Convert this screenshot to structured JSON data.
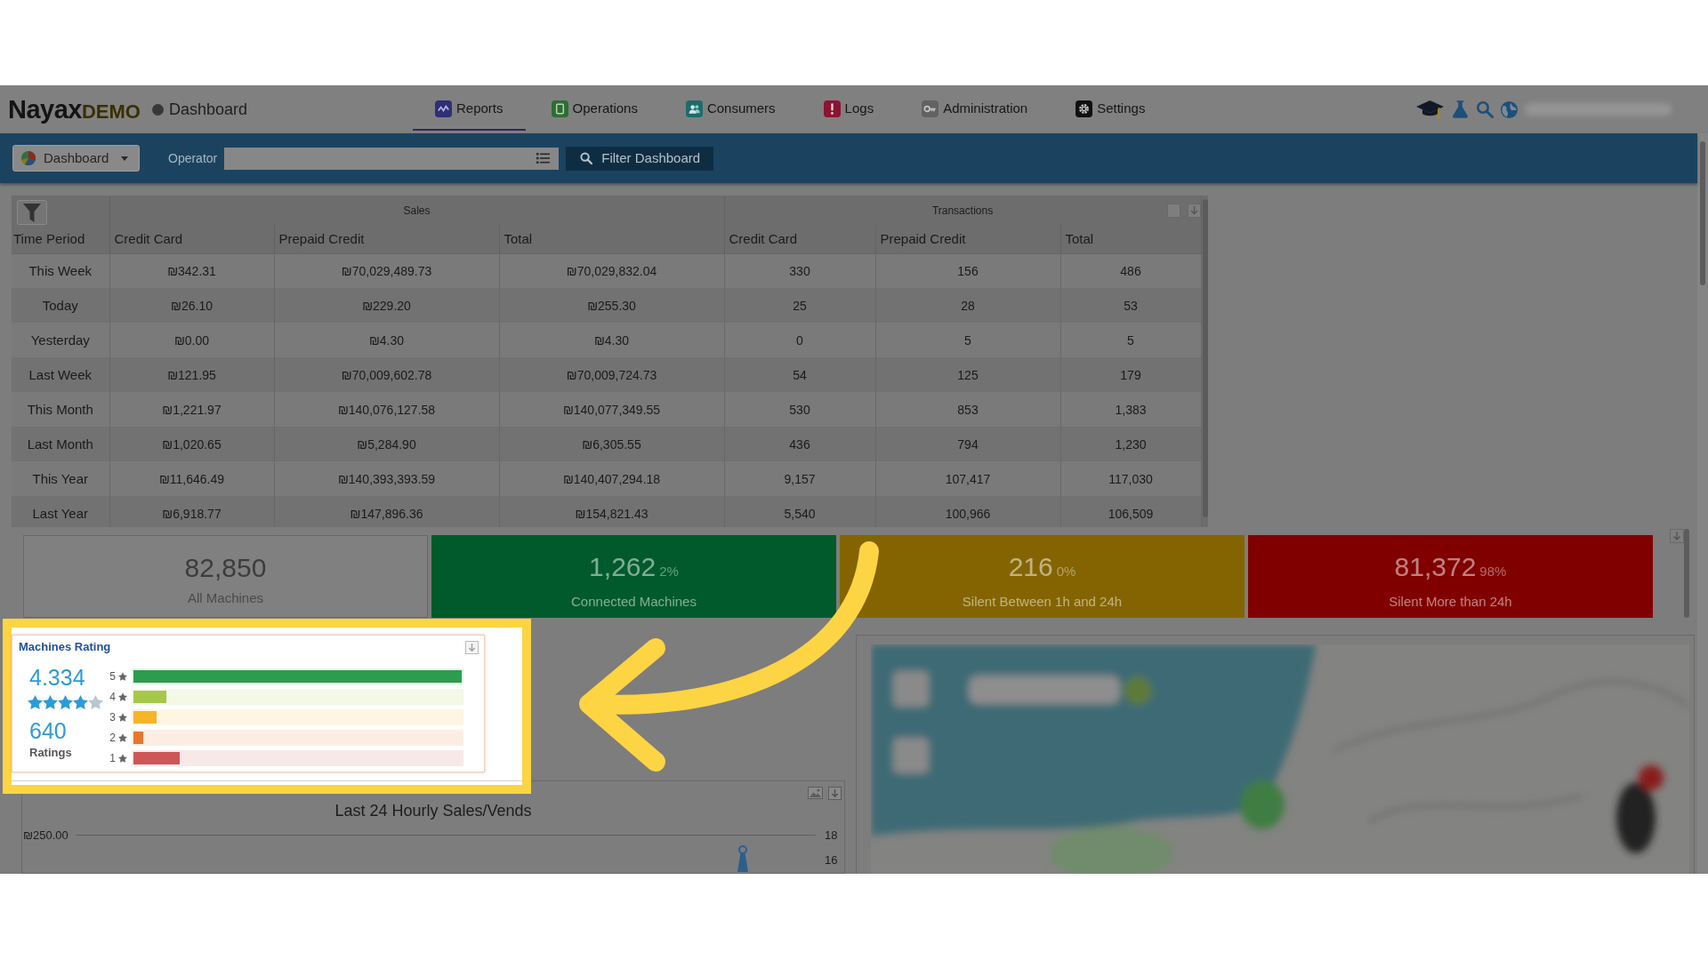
{
  "nav": {
    "logo": "Nayax",
    "logo_tag": "DEMO",
    "page_title": "Dashboard",
    "tabs": [
      {
        "label": "Reports",
        "selected": true
      },
      {
        "label": "Operations",
        "selected": false
      },
      {
        "label": "Consumers",
        "selected": false
      },
      {
        "label": "Logs",
        "selected": false
      },
      {
        "label": "Administration",
        "selected": false
      },
      {
        "label": "Settings",
        "selected": false
      }
    ]
  },
  "toolbar": {
    "dashboard_menu": "Dashboard",
    "operator_label": "Operator",
    "filter_button": "Filter Dashboard"
  },
  "summary_table": {
    "groups": [
      "Sales",
      "Transactions"
    ],
    "columns": [
      "Time Period",
      "Credit Card",
      "Prepaid Credit",
      "Total",
      "Credit Card",
      "Prepaid Credit",
      "Total"
    ],
    "rows": [
      [
        "This Week",
        "₪342.31",
        "₪70,029,489.73",
        "₪70,029,832.04",
        "330",
        "156",
        "486"
      ],
      [
        "Today",
        "₪26.10",
        "₪229.20",
        "₪255.30",
        "25",
        "28",
        "53"
      ],
      [
        "Yesterday",
        "₪0.00",
        "₪4.30",
        "₪4.30",
        "0",
        "5",
        "5"
      ],
      [
        "Last Week",
        "₪121.95",
        "₪70,009,602.78",
        "₪70,009,724.73",
        "54",
        "125",
        "179"
      ],
      [
        "This Month",
        "₪1,221.97",
        "₪140,076,127.58",
        "₪140,077,349.55",
        "530",
        "853",
        "1,383"
      ],
      [
        "Last Month",
        "₪1,020.65",
        "₪5,284.90",
        "₪6,305.55",
        "436",
        "794",
        "1,230"
      ],
      [
        "This Year",
        "₪11,646.49",
        "₪140,393,393.59",
        "₪140,407,294.18",
        "9,157",
        "107,417",
        "117,030"
      ],
      [
        "Last Year",
        "₪6,918.77",
        "₪147,896.36",
        "₪154,821.43",
        "5,540",
        "100,966",
        "106,509"
      ]
    ]
  },
  "machine_status": [
    {
      "kind": "outline",
      "count": "82,850",
      "label": "All Machines",
      "color": "#808080"
    },
    {
      "kind": "filled",
      "count": "1,262",
      "percent": "2%",
      "label": "Connected Machines",
      "color": "#005a2b"
    },
    {
      "kind": "filled",
      "count": "216",
      "percent": "0%",
      "label": "Silent Between 1h and 24h",
      "color": "#846400"
    },
    {
      "kind": "filled",
      "count": "81,372",
      "percent": "98%",
      "label": "Silent More than 24h",
      "color": "#800000"
    }
  ],
  "machines_rating": {
    "title": "Machines Rating",
    "average": "4.334",
    "stars": 4,
    "count": "640",
    "count_label": "Ratings",
    "bars": [
      {
        "label": "5",
        "level": 1,
        "color": "#2e9c4e"
      },
      {
        "label": "4",
        "level": 0.1,
        "color": "#a6c84a"
      },
      {
        "label": "3",
        "level": 0.07,
        "color": "#f5b429"
      },
      {
        "label": "2",
        "level": 0.03,
        "color": "#e8772c"
      },
      {
        "label": "1",
        "level": 0.14,
        "color": "#cf5656"
      }
    ]
  },
  "hourly_chart": {
    "title": "Last 24 Hourly Sales/Vends",
    "left_ticks": [
      "₪250.00"
    ],
    "right_ticks": [
      "18",
      "16"
    ]
  }
}
